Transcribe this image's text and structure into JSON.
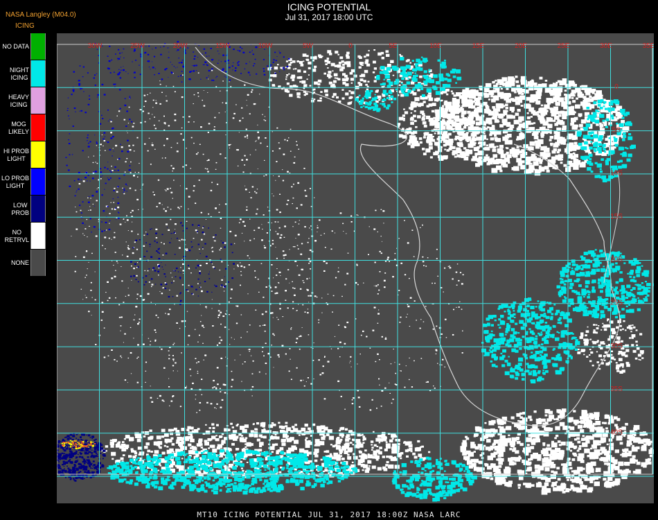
{
  "header": {
    "organization": "NASA Langley (M04.0)",
    "title": "ICING POTENTIAL",
    "datetime": "Jul 31, 2017 18:00 UTC"
  },
  "legend": {
    "title": "ICING",
    "items": [
      {
        "label_lines": [
          "NO DATA"
        ],
        "color": "#00b000"
      },
      {
        "label_lines": [
          "NIGHT",
          "ICING"
        ],
        "color": "#00e8e8"
      },
      {
        "label_lines": [
          "HEAVY",
          "ICING"
        ],
        "color": "#e0a0e0"
      },
      {
        "label_lines": [
          "MOG",
          "LIKELY"
        ],
        "color": "#ff0000"
      },
      {
        "label_lines": [
          "HI PROB",
          "LIGHT"
        ],
        "color": "#ffff00"
      },
      {
        "label_lines": [
          "LO PROB",
          "LIGHT"
        ],
        "color": "#0000ff"
      },
      {
        "label_lines": [
          "LOW",
          "PROB"
        ],
        "color": "#000080"
      },
      {
        "label_lines": [
          "NO",
          "RETRVL"
        ],
        "color": "#ffffff"
      },
      {
        "label_lines": [
          "NONE"
        ],
        "color": "#4a4a4a"
      }
    ]
  },
  "map": {
    "background_color": "#4a4a4a",
    "grid_color": "#40e0e0",
    "lat_labels": [
      "0",
      "5S",
      "10S",
      "15S",
      "20S",
      "25S",
      "30S",
      "35S",
      "40S"
    ],
    "lon_labels": [
      "30W",
      "25W",
      "20W",
      "15W",
      "10W",
      "5W",
      "0",
      "5E",
      "10E",
      "15E",
      "20E",
      "25E",
      "30E",
      "35E"
    ],
    "grid_cols": 14,
    "grid_rows": 10
  },
  "footer": {
    "text": "MT10  ICING POTENTIAL   JUL 31, 2017 18:00Z   NASA LARC"
  }
}
